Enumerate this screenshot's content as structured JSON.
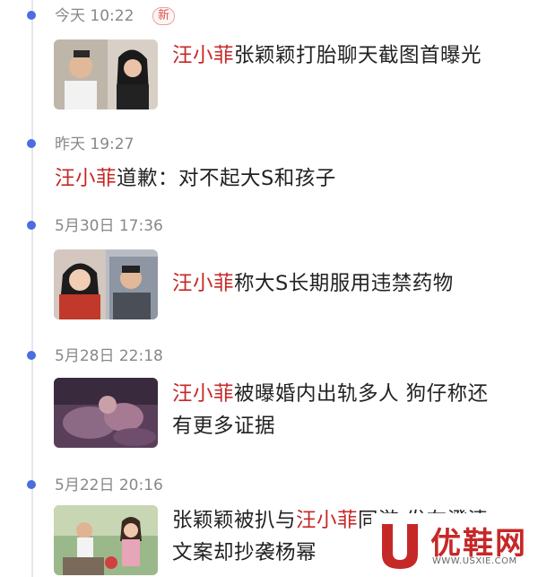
{
  "new_badge": "新",
  "highlight_name": "汪小菲",
  "entries": [
    {
      "time": "今天 10:22",
      "before": "",
      "after": "张颖颖打胎聊天截图首曝光"
    },
    {
      "time": "昨天 19:27",
      "before": "",
      "after": "道歉：对不起大S和孩子"
    },
    {
      "time": "5月30日 17:36",
      "before": "",
      "after": "称大S长期服用违禁药物"
    },
    {
      "time": "5月28日 22:18",
      "before": "",
      "after": "被曝婚内出轨多人 狗仔称还有更多证据"
    },
    {
      "time": "5月22日 20:16",
      "before": "张颖颖被扒与",
      "after": "同游 发布澄清文案却抄袭杨幂"
    }
  ],
  "watermark": {
    "brand": "优鞋网",
    "url": "WWW.USXIE.COM"
  },
  "colors": {
    "timeline_dot": "#4a6de0",
    "highlight": "#c62828",
    "timestamp": "#888888"
  },
  "icons": {
    "thumb1": "couple-photo",
    "thumb3": "couple-photo",
    "thumb4": "blurred-scene-photo",
    "thumb5": "outdoor-couple-photo"
  }
}
